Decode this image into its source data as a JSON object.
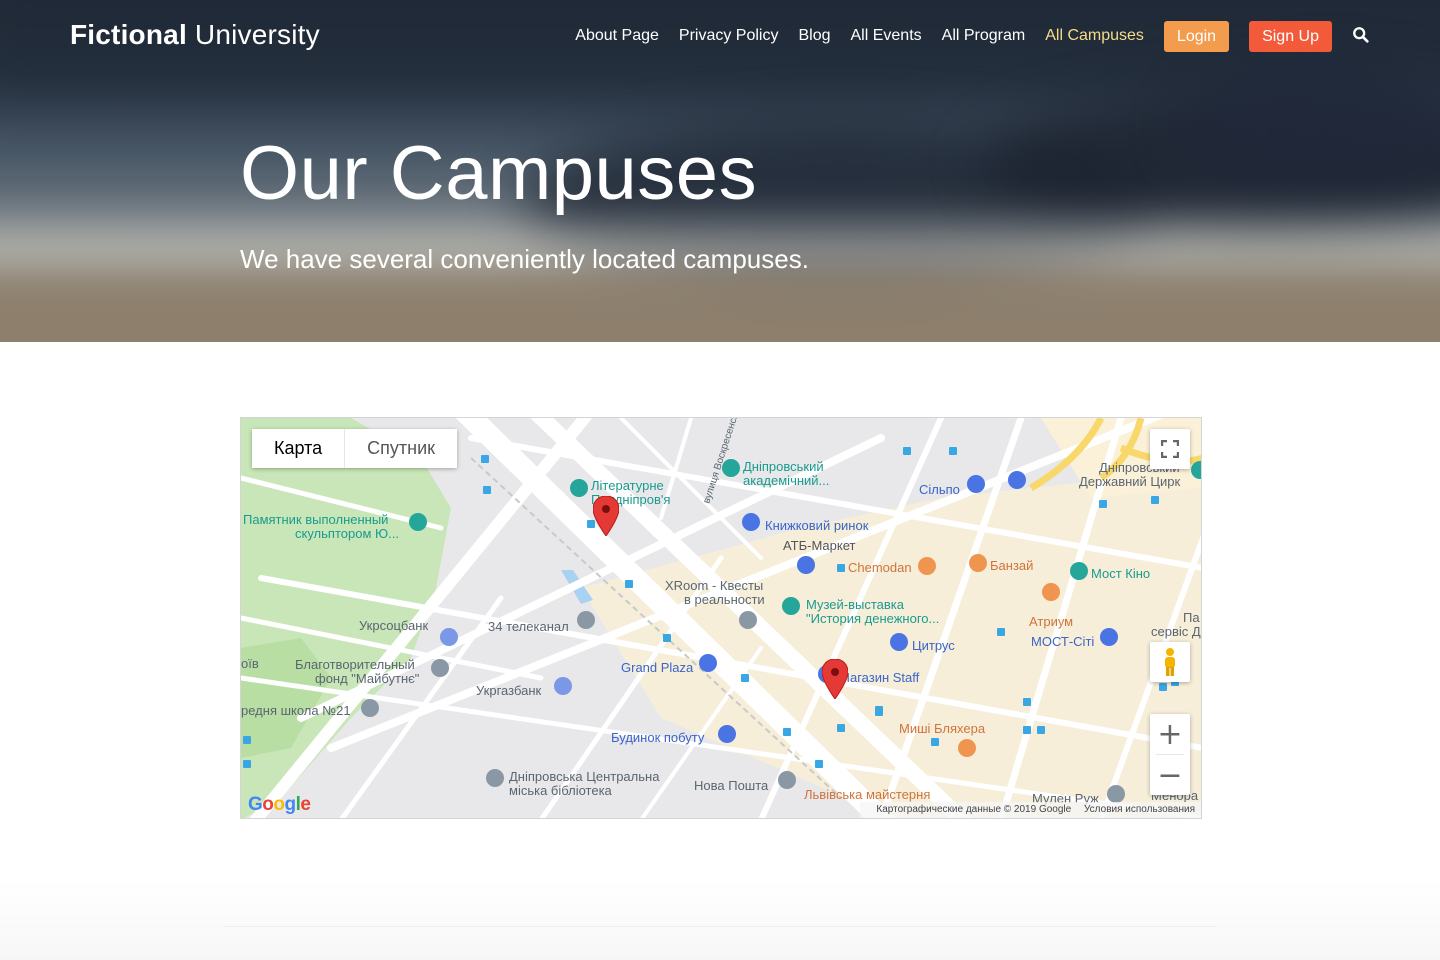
{
  "site": {
    "logo_bold": "Fictional",
    "logo_light": "University"
  },
  "nav": {
    "items": [
      {
        "label": "About Page"
      },
      {
        "label": "Privacy Policy"
      },
      {
        "label": "Blog"
      },
      {
        "label": "All Events"
      },
      {
        "label": "All Program"
      },
      {
        "label": "All Campuses",
        "active": true
      }
    ],
    "login_label": "Login",
    "signup_label": "Sign Up",
    "search_icon": "search-icon"
  },
  "banner": {
    "title": "Our Campuses",
    "subtitle": "We have several conveniently located campuses."
  },
  "map": {
    "type_map_label": "Карта",
    "type_satellite_label": "Спутник",
    "zoom_in": "+",
    "zoom_out": "−",
    "google_logo": "Google",
    "attribution": "Картографические данные © 2019 Google",
    "terms": "Условия использования",
    "places": [
      "Літературне",
      "Придніпров'я",
      "Дніпровський",
      "академічний...",
      "Памятник выполненный",
      "скульптором Ю...",
      "Книжковий ринок",
      "АТБ-Маркет",
      "Chemodan",
      "Банзай",
      "Мост Кіно",
      "Сільпо",
      "Дніпровський",
      "Державний Цирк",
      "XRoom - Квесты",
      "в реальности",
      "Музей-выставка",
      "\"История денежного...",
      "Укрсоцбанк",
      "34 телеканал",
      "Атриум",
      "МОСТ-Сіті",
      "Цитрус",
      "Grand Plaza",
      "Благотворительный",
      "фонд \"Майбутнє\"",
      "Укргазбанк",
      "Магазин Staff",
      "редня школа №21",
      "Миші Бляхера",
      "Будинок побуту",
      "Дніпровська Центральна",
      "міська бібліотека",
      "Нова Пошта",
      "Львівська майстерня",
      "Мулен Руж",
      "Менора",
      "вулиця Воскресенсь",
      "Па",
      "сервіс Д",
      "оїв"
    ],
    "markers": 2
  }
}
